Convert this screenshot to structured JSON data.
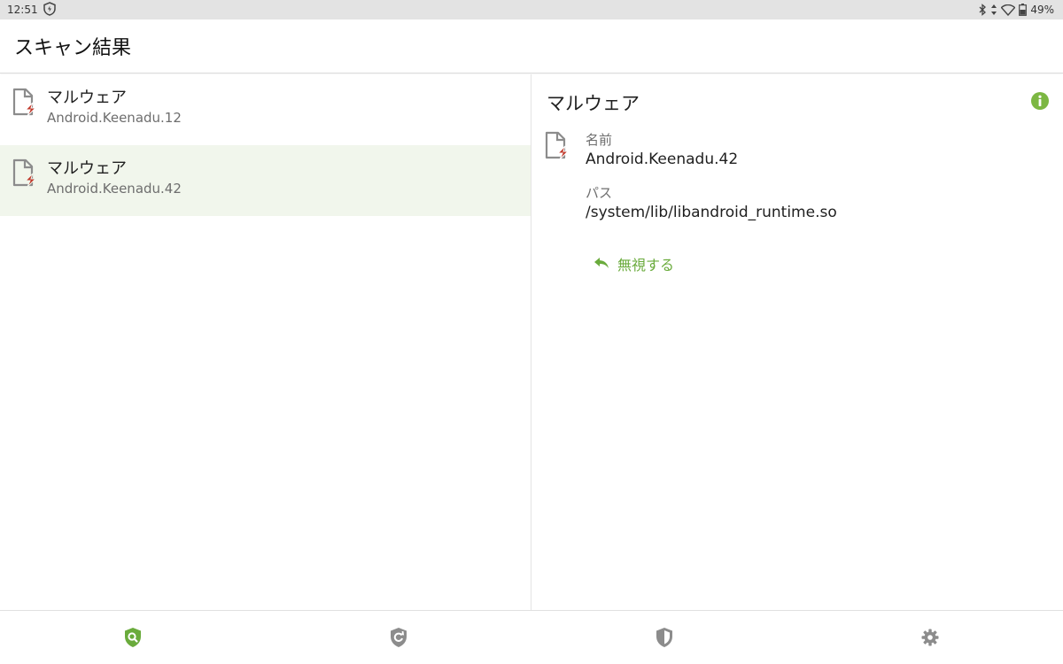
{
  "status_bar": {
    "time": "12:51",
    "battery": "49%"
  },
  "app_bar": {
    "title": "スキャン結果"
  },
  "list": {
    "items": [
      {
        "title": "マルウェア",
        "subtitle": "Android.Keenadu.12",
        "selected": false
      },
      {
        "title": "マルウェア",
        "subtitle": "Android.Keenadu.42",
        "selected": true
      }
    ]
  },
  "detail": {
    "title": "マルウェア",
    "name_label": "名前",
    "name_value": "Android.Keenadu.42",
    "path_label": "パス",
    "path_value": "/system/lib/libandroid_runtime.so",
    "ignore_label": "無視する"
  },
  "bottom_nav": {
    "items": [
      {
        "icon": "scan-shield-icon",
        "active": true
      },
      {
        "icon": "update-shield-icon",
        "active": false
      },
      {
        "icon": "security-shield-icon",
        "active": false
      },
      {
        "icon": "gear-icon",
        "active": false
      }
    ]
  },
  "colors": {
    "accent": "#6aab3c",
    "threat": "#c0392b",
    "icon_gray": "#8c8c8c",
    "selected_bg": "#f1f6ec"
  }
}
